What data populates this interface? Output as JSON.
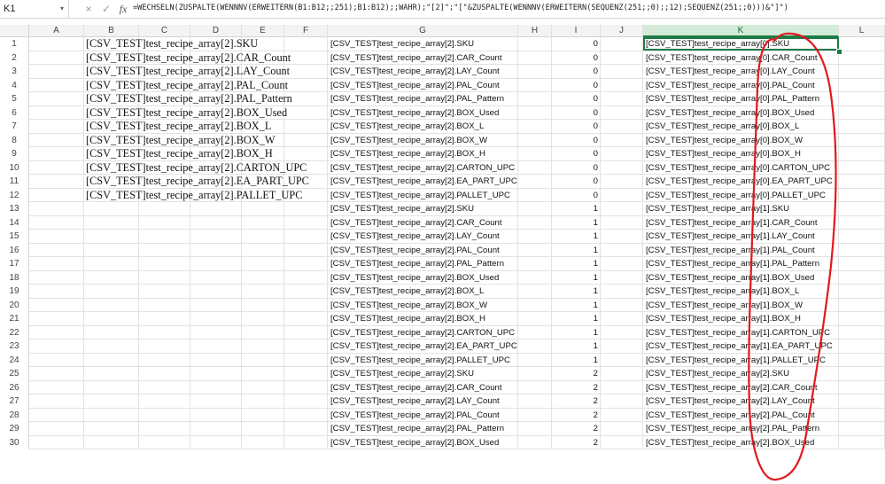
{
  "formula_bar": {
    "name_box": "K1",
    "cancel_icon": "×",
    "enter_icon": "✓",
    "fx_label": "fx",
    "formula": "=WECHSELN(ZUSPALTE(WENNNV(ERWEITERN(B1:B12;;251);B1:B12);;WAHR);\"[2]\";\"[\"&ZUSPALTE(WENNNV(ERWEITERN(SEQUENZ(251;;0);;12);SEQUENZ(251;;0)))&\"]\")"
  },
  "columns": [
    "A",
    "B",
    "C",
    "D",
    "E",
    "F",
    "G",
    "H",
    "I",
    "J",
    "K",
    "L"
  ],
  "selected_column": "K",
  "rows": [
    {
      "n": "1",
      "b": "[CSV_TEST]test_recipe_array[2].SKU",
      "g": "[CSV_TEST]test_recipe_array[2].SKU",
      "i": "0",
      "k": "[CSV_TEST]test_recipe_array[0].SKU"
    },
    {
      "n": "2",
      "b": "[CSV_TEST]test_recipe_array[2].CAR_Count",
      "g": "[CSV_TEST]test_recipe_array[2].CAR_Count",
      "i": "0",
      "k": "[CSV_TEST]test_recipe_array[0].CAR_Count"
    },
    {
      "n": "3",
      "b": "[CSV_TEST]test_recipe_array[2].LAY_Count",
      "g": "[CSV_TEST]test_recipe_array[2].LAY_Count",
      "i": "0",
      "k": "[CSV_TEST]test_recipe_array[0].LAY_Count"
    },
    {
      "n": "4",
      "b": "[CSV_TEST]test_recipe_array[2].PAL_Count",
      "g": "[CSV_TEST]test_recipe_array[2].PAL_Count",
      "i": "0",
      "k": "[CSV_TEST]test_recipe_array[0].PAL_Count"
    },
    {
      "n": "5",
      "b": "[CSV_TEST]test_recipe_array[2].PAL_Pattern",
      "g": "[CSV_TEST]test_recipe_array[2].PAL_Pattern",
      "i": "0",
      "k": "[CSV_TEST]test_recipe_array[0].PAL_Pattern"
    },
    {
      "n": "6",
      "b": "[CSV_TEST]test_recipe_array[2].BOX_Used",
      "g": "[CSV_TEST]test_recipe_array[2].BOX_Used",
      "i": "0",
      "k": "[CSV_TEST]test_recipe_array[0].BOX_Used"
    },
    {
      "n": "7",
      "b": "[CSV_TEST]test_recipe_array[2].BOX_L",
      "g": "[CSV_TEST]test_recipe_array[2].BOX_L",
      "i": "0",
      "k": "[CSV_TEST]test_recipe_array[0].BOX_L"
    },
    {
      "n": "8",
      "b": "[CSV_TEST]test_recipe_array[2].BOX_W",
      "g": "[CSV_TEST]test_recipe_array[2].BOX_W",
      "i": "0",
      "k": "[CSV_TEST]test_recipe_array[0].BOX_W"
    },
    {
      "n": "9",
      "b": "[CSV_TEST]test_recipe_array[2].BOX_H",
      "g": "[CSV_TEST]test_recipe_array[2].BOX_H",
      "i": "0",
      "k": "[CSV_TEST]test_recipe_array[0].BOX_H"
    },
    {
      "n": "10",
      "b": "[CSV_TEST]test_recipe_array[2].CARTON_UPC",
      "g": "[CSV_TEST]test_recipe_array[2].CARTON_UPC",
      "i": "0",
      "k": "[CSV_TEST]test_recipe_array[0].CARTON_UPC"
    },
    {
      "n": "11",
      "b": "[CSV_TEST]test_recipe_array[2].EA_PART_UPC",
      "g": "[CSV_TEST]test_recipe_array[2].EA_PART_UPC",
      "i": "0",
      "k": "[CSV_TEST]test_recipe_array[0].EA_PART_UPC"
    },
    {
      "n": "12",
      "b": "[CSV_TEST]test_recipe_array[2].PALLET_UPC",
      "g": "[CSV_TEST]test_recipe_array[2].PALLET_UPC",
      "i": "0",
      "k": "[CSV_TEST]test_recipe_array[0].PALLET_UPC"
    },
    {
      "n": "13",
      "b": "",
      "g": "[CSV_TEST]test_recipe_array[2].SKU",
      "i": "1",
      "k": "[CSV_TEST]test_recipe_array[1].SKU"
    },
    {
      "n": "14",
      "b": "",
      "g": "[CSV_TEST]test_recipe_array[2].CAR_Count",
      "i": "1",
      "k": "[CSV_TEST]test_recipe_array[1].CAR_Count"
    },
    {
      "n": "15",
      "b": "",
      "g": "[CSV_TEST]test_recipe_array[2].LAY_Count",
      "i": "1",
      "k": "[CSV_TEST]test_recipe_array[1].LAY_Count"
    },
    {
      "n": "16",
      "b": "",
      "g": "[CSV_TEST]test_recipe_array[2].PAL_Count",
      "i": "1",
      "k": "[CSV_TEST]test_recipe_array[1].PAL_Count"
    },
    {
      "n": "17",
      "b": "",
      "g": "[CSV_TEST]test_recipe_array[2].PAL_Pattern",
      "i": "1",
      "k": "[CSV_TEST]test_recipe_array[1].PAL_Pattern"
    },
    {
      "n": "18",
      "b": "",
      "g": "[CSV_TEST]test_recipe_array[2].BOX_Used",
      "i": "1",
      "k": "[CSV_TEST]test_recipe_array[1].BOX_Used"
    },
    {
      "n": "19",
      "b": "",
      "g": "[CSV_TEST]test_recipe_array[2].BOX_L",
      "i": "1",
      "k": "[CSV_TEST]test_recipe_array[1].BOX_L"
    },
    {
      "n": "20",
      "b": "",
      "g": "[CSV_TEST]test_recipe_array[2].BOX_W",
      "i": "1",
      "k": "[CSV_TEST]test_recipe_array[1].BOX_W"
    },
    {
      "n": "21",
      "b": "",
      "g": "[CSV_TEST]test_recipe_array[2].BOX_H",
      "i": "1",
      "k": "[CSV_TEST]test_recipe_array[1].BOX_H"
    },
    {
      "n": "22",
      "b": "",
      "g": "[CSV_TEST]test_recipe_array[2].CARTON_UPC",
      "i": "1",
      "k": "[CSV_TEST]test_recipe_array[1].CARTON_UPC"
    },
    {
      "n": "23",
      "b": "",
      "g": "[CSV_TEST]test_recipe_array[2].EA_PART_UPC",
      "i": "1",
      "k": "[CSV_TEST]test_recipe_array[1].EA_PART_UPC"
    },
    {
      "n": "24",
      "b": "",
      "g": "[CSV_TEST]test_recipe_array[2].PALLET_UPC",
      "i": "1",
      "k": "[CSV_TEST]test_recipe_array[1].PALLET_UPC"
    },
    {
      "n": "25",
      "b": "",
      "g": "[CSV_TEST]test_recipe_array[2].SKU",
      "i": "2",
      "k": "[CSV_TEST]test_recipe_array[2].SKU"
    },
    {
      "n": "26",
      "b": "",
      "g": "[CSV_TEST]test_recipe_array[2].CAR_Count",
      "i": "2",
      "k": "[CSV_TEST]test_recipe_array[2].CAR_Count"
    },
    {
      "n": "27",
      "b": "",
      "g": "[CSV_TEST]test_recipe_array[2].LAY_Count",
      "i": "2",
      "k": "[CSV_TEST]test_recipe_array[2].LAY_Count"
    },
    {
      "n": "28",
      "b": "",
      "g": "[CSV_TEST]test_recipe_array[2].PAL_Count",
      "i": "2",
      "k": "[CSV_TEST]test_recipe_array[2].PAL_Count"
    },
    {
      "n": "29",
      "b": "",
      "g": "[CSV_TEST]test_recipe_array[2].PAL_Pattern",
      "i": "2",
      "k": "[CSV_TEST]test_recipe_array[2].PAL_Pattern"
    },
    {
      "n": "30",
      "b": "",
      "g": "[CSV_TEST]test_recipe_array[2].BOX_Used",
      "i": "2",
      "k": "[CSV_TEST]test_recipe_array[2].BOX_Used"
    }
  ],
  "colors": {
    "selection": "#1d7b45",
    "annotation": "#e0191e"
  }
}
